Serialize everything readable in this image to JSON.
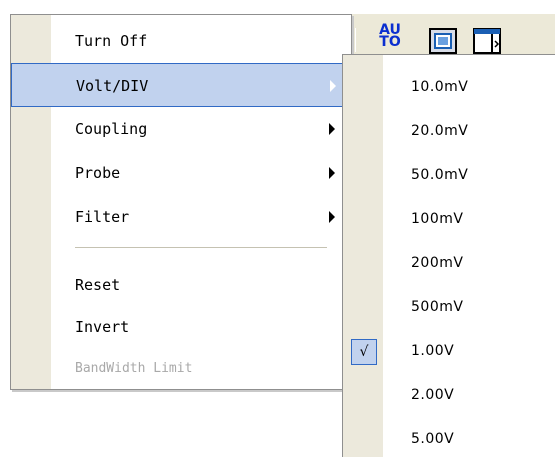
{
  "toolbar": {
    "auto_label_line1": "AU",
    "auto_label_line2": "TO",
    "fit_icon": "zoom-fit-icon",
    "window_icon": "window-split-icon"
  },
  "menu": {
    "items": [
      {
        "label": "Turn Off",
        "has_submenu": false,
        "highlighted": false,
        "enabled": true
      },
      {
        "label": "Volt/DIV",
        "has_submenu": true,
        "highlighted": true,
        "enabled": true
      },
      {
        "label": "Coupling",
        "has_submenu": true,
        "highlighted": false,
        "enabled": true
      },
      {
        "label": "Probe",
        "has_submenu": true,
        "highlighted": false,
        "enabled": true
      },
      {
        "label": "Filter",
        "has_submenu": true,
        "highlighted": false,
        "enabled": true
      },
      {
        "label": "Reset",
        "has_submenu": false,
        "highlighted": false,
        "enabled": true
      },
      {
        "label": "Invert",
        "has_submenu": false,
        "highlighted": false,
        "enabled": true
      },
      {
        "label": "BandWidth Limit",
        "has_submenu": false,
        "highlighted": false,
        "enabled": false
      }
    ]
  },
  "submenu": {
    "items": [
      {
        "label": "10.0mV",
        "checked": false
      },
      {
        "label": "20.0mV",
        "checked": false
      },
      {
        "label": "50.0mV",
        "checked": false
      },
      {
        "label": "100mV",
        "checked": false
      },
      {
        "label": "200mV",
        "checked": false
      },
      {
        "label": "500mV",
        "checked": false
      },
      {
        "label": "1.00V",
        "checked": true
      },
      {
        "label": "2.00V",
        "checked": false
      },
      {
        "label": "5.00V",
        "checked": false
      }
    ],
    "check_mark": "√"
  },
  "colors": {
    "highlight_fill": "#c1d2ee",
    "highlight_border": "#316ac5",
    "gutter": "#ece9dc",
    "disabled_text": "#a9a9a9"
  }
}
